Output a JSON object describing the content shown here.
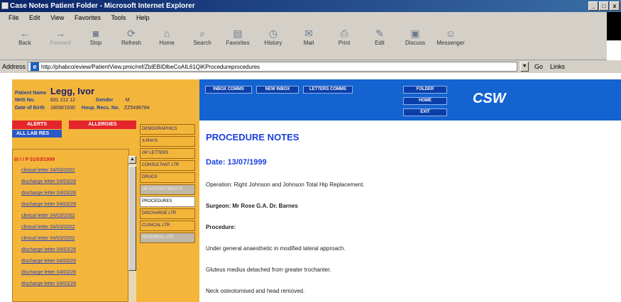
{
  "window": {
    "title": "Case Notes Patient Folder - Microsoft Internet Explorer",
    "controls": [
      "_",
      "□",
      "x"
    ]
  },
  "menu": [
    "File",
    "Edit",
    "View",
    "Favorites",
    "Tools",
    "Help"
  ],
  "toolbar": {
    "buttons": [
      {
        "label": "Back",
        "icon": "back-arrow"
      },
      {
        "label": "Forward",
        "icon": "forward-arrow"
      },
      {
        "label": "Stop",
        "icon": "stop-icon"
      },
      {
        "label": "Refresh",
        "icon": "refresh-icon"
      },
      {
        "label": "Home",
        "icon": "home-icon"
      },
      {
        "label": "Search",
        "icon": "search-icon"
      },
      {
        "label": "Favorites",
        "icon": "favorites-icon"
      },
      {
        "label": "History",
        "icon": "history-icon"
      },
      {
        "label": "Mail",
        "icon": "mail-icon"
      },
      {
        "label": "Print",
        "icon": "print-icon"
      },
      {
        "label": "Edit",
        "icon": "edit-icon"
      },
      {
        "label": "Discuss",
        "icon": "discuss-icon"
      },
      {
        "label": "Messenger",
        "icon": "messenger-icon"
      }
    ]
  },
  "address": {
    "label": "Address",
    "url": "http://phabco/eview/PatientView.pmic/ref/ZbIEBIDlbeCoAIL61QiKProcedureprocedures",
    "go": "Go",
    "links": "Links"
  },
  "patient": {
    "name_label": "Patient Name",
    "name": "Legg, Ivor",
    "nhs_label": "NHS No.",
    "nhs": "631 212 12",
    "gender_label": "Gender",
    "gender": "M",
    "dob_label": "Date of Birth",
    "dob": "18/06/1930",
    "hosp_label": "Hosp. Recs. No.",
    "hosp": "ZZ5496784"
  },
  "header_buttons": {
    "inbox": "INBOX COMMS",
    "new_inbox": "NEW INBOX",
    "letters": "LETTERS COMMS",
    "folder": "FOLDER",
    "home": "HOME",
    "exit": "EXIT",
    "logo": "CSW"
  },
  "left": {
    "alerts": "ALERTS",
    "allergies": "ALLERGIES",
    "all_lab_res": "ALL LAB RES",
    "tree_root": "I / P 01/03/1999",
    "items": [
      "clinical letter 04/03/2002",
      "discharge letter 04/03/28",
      "discharge letter 04/03/28",
      "discharge letter 04/03/28",
      "clinical letter 04/03/2002",
      "clinical letter 04/03/2002",
      "clinical letter 04/03/2002",
      "discharge letter 04/03/28",
      "discharge letter 04/03/28",
      "discharge letter 04/03/28",
      "discharge letter 04/03/28"
    ]
  },
  "tabs": [
    {
      "label": "DEMOGRAPHICS",
      "state": "normal"
    },
    {
      "label": "X-RAYS",
      "state": "normal"
    },
    {
      "label": "GP LETTERS",
      "state": "normal"
    },
    {
      "label": "CONSULTANT LTR",
      "state": "normal"
    },
    {
      "label": "DRUGS",
      "state": "normal"
    },
    {
      "label": "OP APPOINTMENTS",
      "state": "greyed"
    },
    {
      "label": "PROCEDURES",
      "state": "active"
    },
    {
      "label": "DISCHARGE LTR",
      "state": "normal"
    },
    {
      "label": "CLINICAL LTR",
      "state": "normal"
    },
    {
      "label": "REFERRAL LTR",
      "state": "greyed"
    }
  ],
  "content": {
    "title": "PROCEDURE NOTES",
    "date": "Date: 13/07/1999",
    "operation": "Operation: Right Johnson and Johnson Total Hip Replacement.",
    "surgeon": "Surgeon: Mr Rose G.A. Dr. Barnes",
    "procedure_label": "Procedure:",
    "line1": "Under general anaesthetic in modified lateral approach.",
    "line2": "Gluteus medius detached from greater trochanter.",
    "line3": "Neck osteotomised and head removed."
  }
}
